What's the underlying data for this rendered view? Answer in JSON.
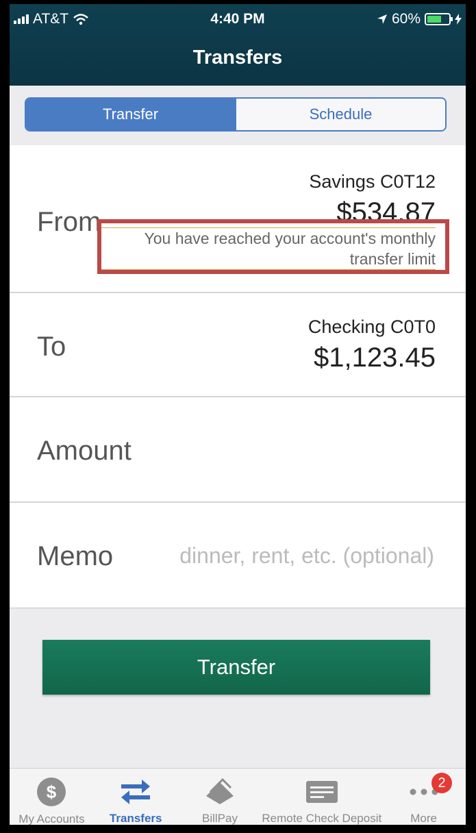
{
  "status_bar": {
    "carrier": "AT&T",
    "time": "4:40 PM",
    "battery": "60%",
    "battery_level": 0.6
  },
  "header": {
    "title": "Transfers"
  },
  "segmented": {
    "transfer_label": "Transfer",
    "schedule_label": "Schedule",
    "selected": "Transfer"
  },
  "from": {
    "label": "From",
    "account_name": "Savings C0T12",
    "balance": "$534.87",
    "warning": "You have reached your account's monthly transfer limit"
  },
  "to": {
    "label": "To",
    "account_name": "Checking C0T0",
    "balance": "$1,123.45"
  },
  "amount": {
    "label": "Amount"
  },
  "memo": {
    "label": "Memo",
    "placeholder": "dinner, rent, etc. (optional)"
  },
  "transfer_button": {
    "label": "Transfer"
  },
  "tabbar": {
    "items": [
      {
        "label": "My Accounts",
        "icon": "dollar-circle-icon"
      },
      {
        "label": "Transfers",
        "icon": "transfer-arrows-icon",
        "active": true
      },
      {
        "label": "BillPay",
        "icon": "billpay-icon"
      },
      {
        "label": "Remote Check Deposit",
        "icon": "check-icon"
      },
      {
        "label": "More",
        "icon": "more-icon",
        "badge": "2"
      }
    ]
  },
  "colors": {
    "header": "#0f4050",
    "accent": "#4a7cc4",
    "button": "#1a7b5c",
    "highlight": "#b94a48",
    "badge": "#e53935"
  }
}
